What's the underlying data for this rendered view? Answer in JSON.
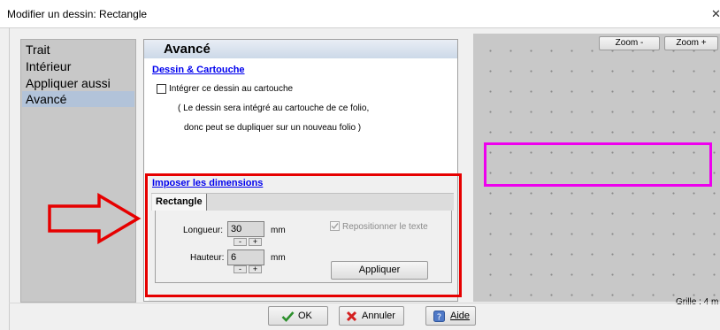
{
  "window": {
    "title": "Modifier un dessin: Rectangle",
    "close_glyph": "✕"
  },
  "nav": {
    "items": [
      "Trait",
      "Intérieur",
      "Appliquer aussi",
      "Avancé"
    ],
    "selected_index": 3
  },
  "panel": {
    "title": "Avancé",
    "dessin": {
      "heading": "Dessin & Cartouche",
      "checkbox_label": "Intégrer ce dessin au cartouche",
      "checked": false,
      "note_line1": "( Le dessin sera intégré au cartouche de ce folio,",
      "note_line2": "donc peut se dupliquer sur un nouveau folio )"
    },
    "dimensions": {
      "heading": "Imposer les dimensions",
      "tab": "Rectangle",
      "longueur_label": "Longueur:",
      "longueur_value": "30",
      "longueur_unit": "mm",
      "hauteur_label": "Hauteur:",
      "hauteur_value": "6",
      "hauteur_unit": "mm",
      "minus": "-",
      "plus": "+",
      "reposition_label": "Repositionner le texte",
      "reposition_checked": true,
      "apply_label": "Appliquer"
    }
  },
  "preview": {
    "zoom_out": "Zoom -",
    "zoom_in": "Zoom +",
    "grid_label": "Grille : 4 m"
  },
  "footer": {
    "ok": "OK",
    "cancel": "Annuler",
    "help": "Aide"
  },
  "annotations": {
    "arrow_color": "#e60000",
    "frame_color": "#e60000",
    "highlight_color": "#ee00ee"
  }
}
